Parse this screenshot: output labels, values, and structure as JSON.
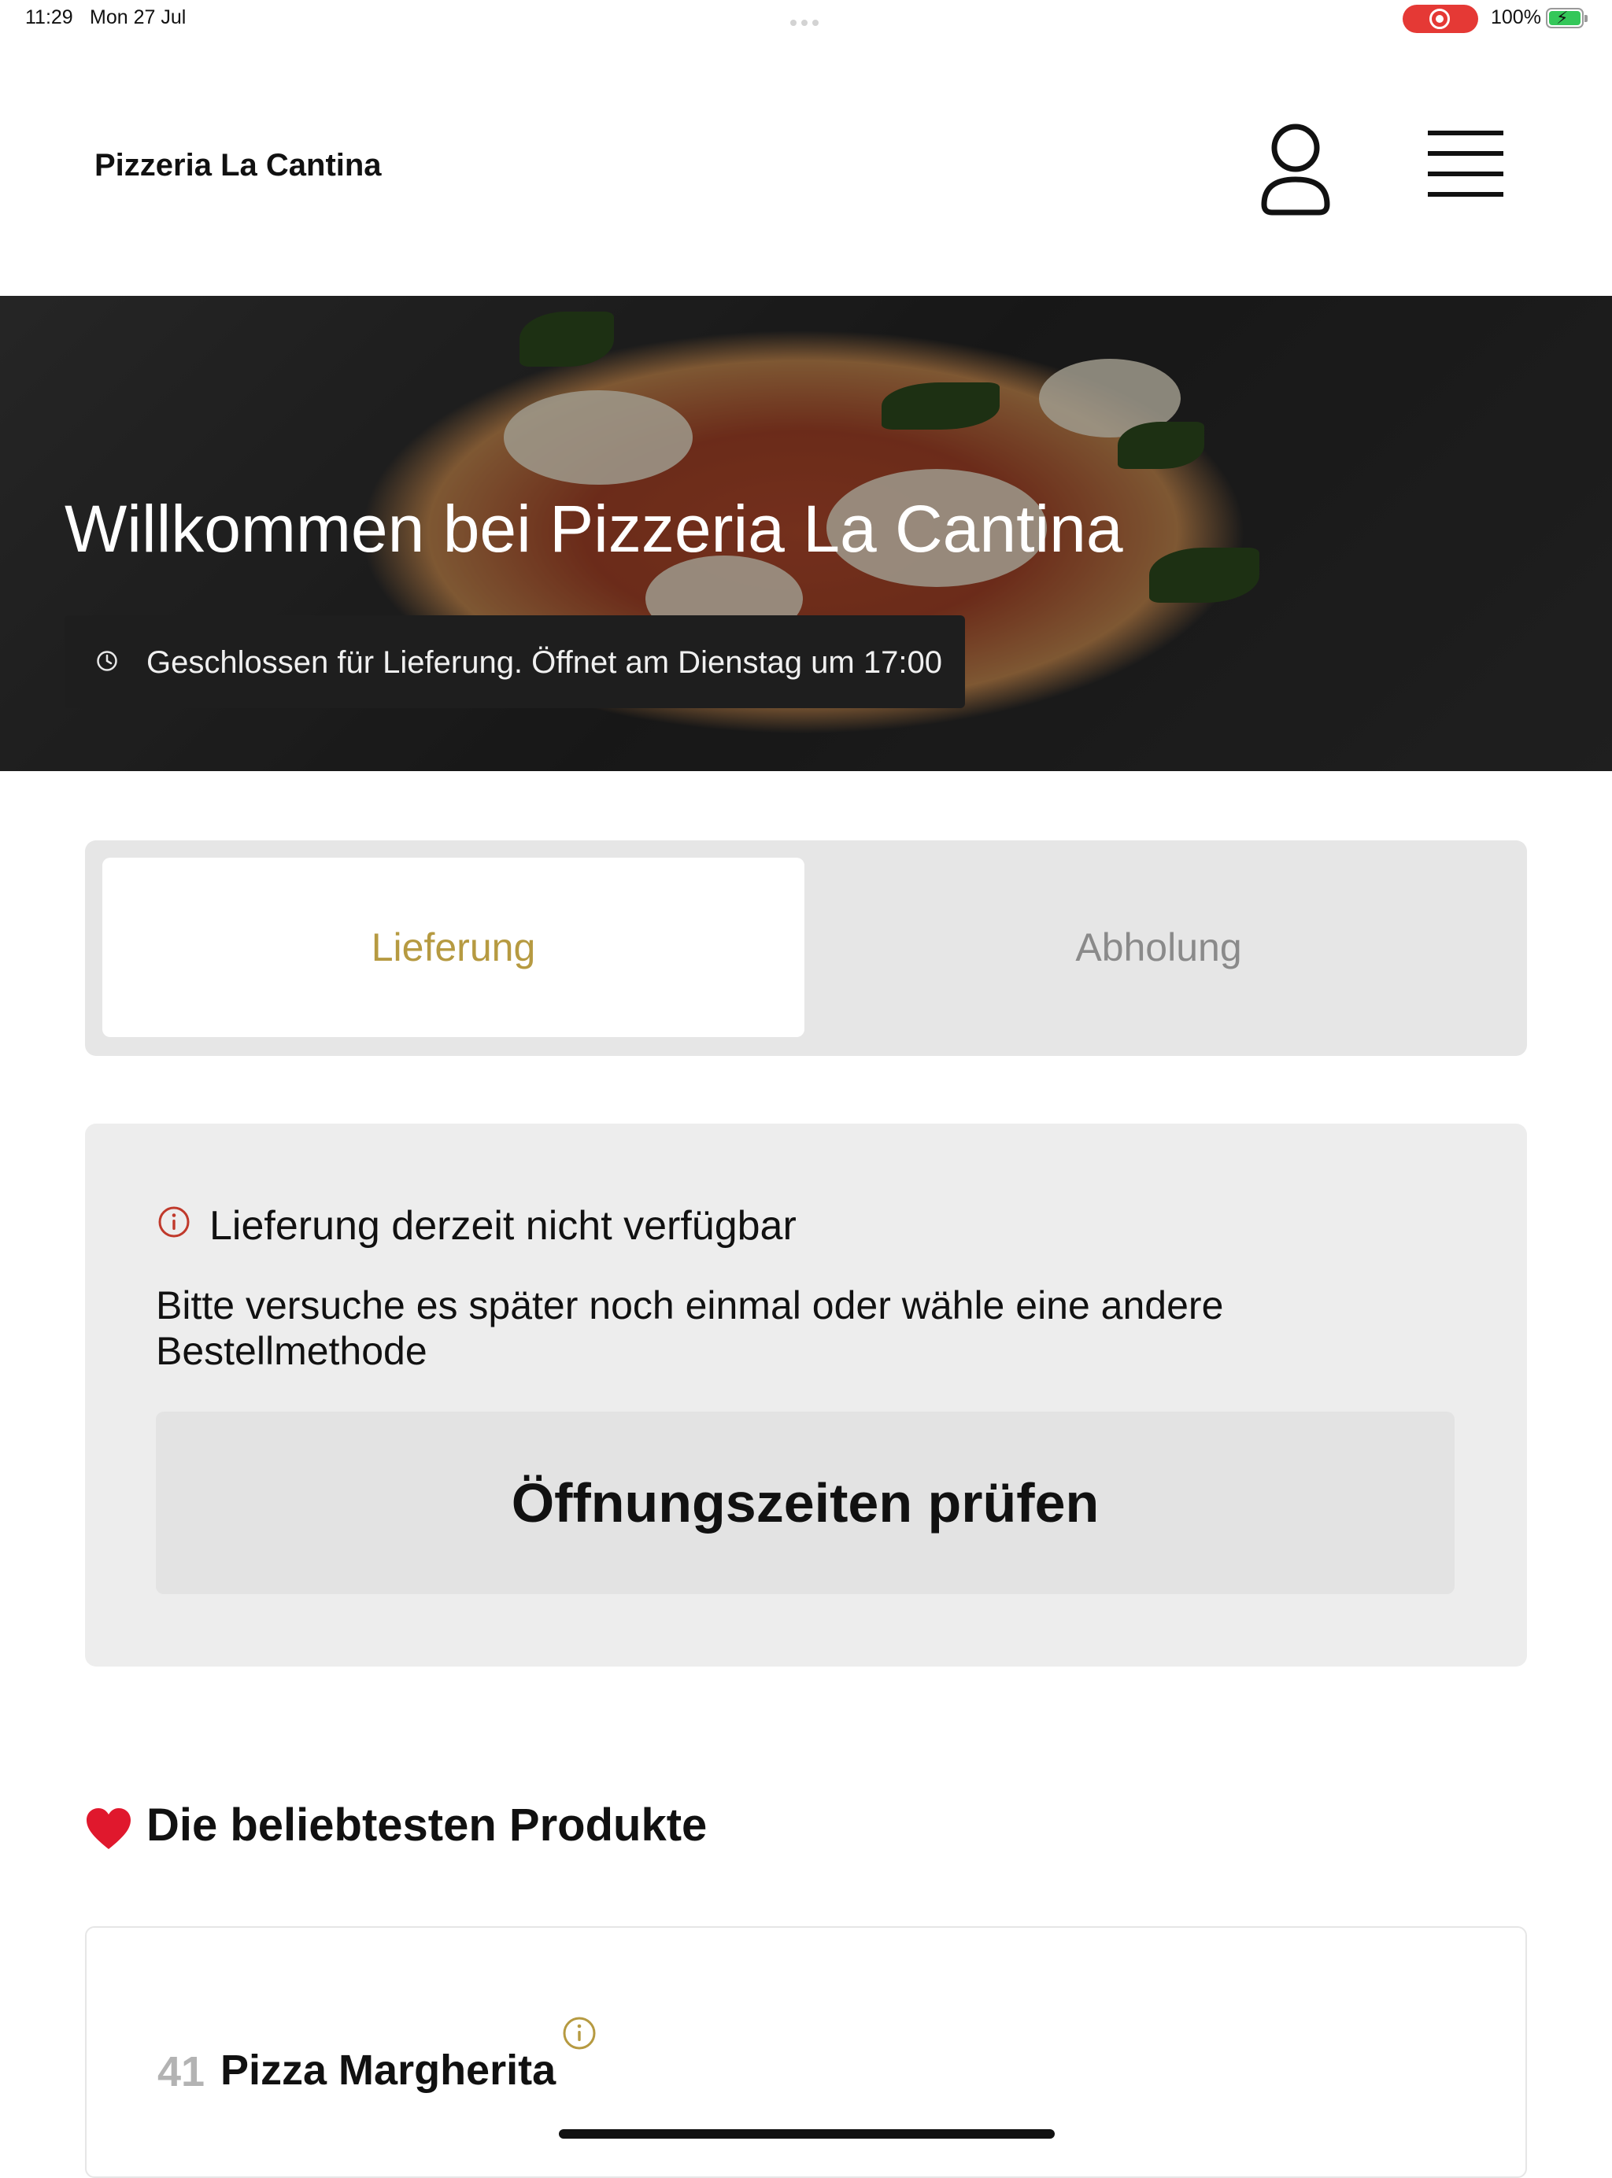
{
  "status_bar": {
    "time": "11:29",
    "date": "Mon 27 Jul",
    "battery": "100%",
    "recording_color": "#e53935",
    "battery_color": "#34c759"
  },
  "header": {
    "brand": "Pizzeria La Cantina",
    "account_icon": "user-icon",
    "menu_icon": "hamburger-menu-icon"
  },
  "hero": {
    "title": "Willkommen bei Pizzeria La Cantina",
    "status": "Geschlossen für Lieferung. Öffnet am Dienstag um 17:00",
    "status_icon": "clock-icon"
  },
  "order_mode": {
    "options": [
      {
        "label": "Lieferung",
        "selected": true
      },
      {
        "label": "Abholung",
        "selected": false
      }
    ],
    "accent_color": "#b69a41"
  },
  "notice": {
    "icon": "info-icon",
    "icon_color": "#c0392b",
    "title": "Lieferung derzeit nicht verfügbar",
    "body": "Bitte versuche es später noch einmal oder wähle eine andere Bestellmethode",
    "button_label": "Öffnungszeiten prüfen"
  },
  "popular": {
    "icon": "heart-icon",
    "heading": "Die beliebtesten Produkte",
    "products": [
      {
        "number": "41",
        "name": "Pizza Margherita",
        "info_icon": "info-icon"
      }
    ]
  }
}
